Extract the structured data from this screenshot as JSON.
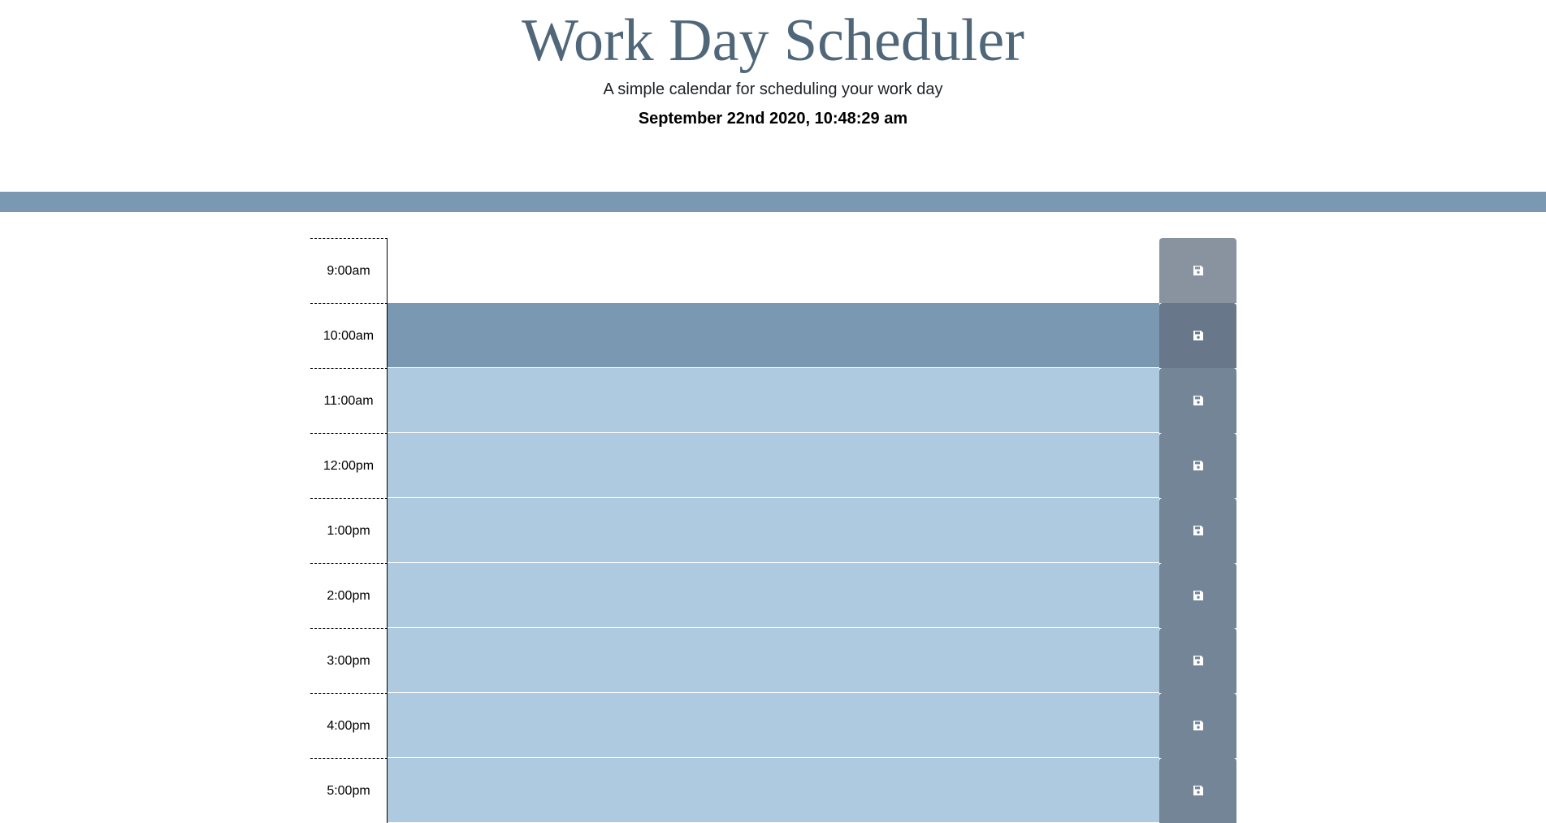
{
  "header": {
    "title": "Work Day Scheduler",
    "subtitle": "A simple calendar for scheduling your work day",
    "current_day": "September 22nd 2020, 10:48:29 am"
  },
  "colors": {
    "past": "#ffffff",
    "present": "#7b98b3",
    "future": "#adcae0",
    "banner": "#7b98b3",
    "title": "#4f6779"
  },
  "schedule": {
    "save_icon": "floppy-disk-icon",
    "rows": [
      {
        "hour": "9:00am",
        "status": "past",
        "text": ""
      },
      {
        "hour": "10:00am",
        "status": "present",
        "text": ""
      },
      {
        "hour": "11:00am",
        "status": "future",
        "text": ""
      },
      {
        "hour": "12:00pm",
        "status": "future",
        "text": ""
      },
      {
        "hour": "1:00pm",
        "status": "future",
        "text": ""
      },
      {
        "hour": "2:00pm",
        "status": "future",
        "text": ""
      },
      {
        "hour": "3:00pm",
        "status": "future",
        "text": ""
      },
      {
        "hour": "4:00pm",
        "status": "future",
        "text": ""
      },
      {
        "hour": "5:00pm",
        "status": "future",
        "text": ""
      }
    ]
  }
}
